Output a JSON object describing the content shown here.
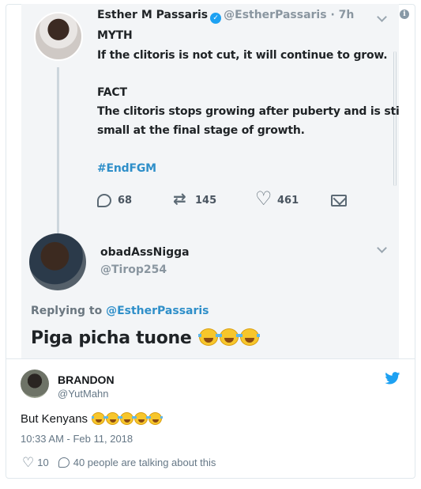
{
  "embedded_tweet": {
    "author_name": "Esther M Passaris",
    "author_handle": "@EstherPassaris",
    "time": "· 7h",
    "lines": [
      "MYTH",
      "If the clitoris is not cut, it will continue to grow.",
      "FACT",
      "The clitoris stops growing after puberty and is still",
      "small at the final stage of growth."
    ],
    "hashtag": "#EndFGM",
    "reply_count": "68",
    "retweet_count": "145",
    "like_count": "461"
  },
  "embedded_reply": {
    "author_name": "obadAssNigga",
    "author_handle": "@Tirop254",
    "replying_prefix": "Replying to",
    "replying_mention": "@EstherPassaris",
    "text": "Piga picha tuone"
  },
  "tweet": {
    "author_name": "BRANDON",
    "author_handle": "@YutMahn",
    "text": "But Kenyans",
    "timestamp": "10:33 AM - Feb 11, 2018",
    "like_count": "10",
    "talking": "40 people are talking about this"
  },
  "icons": {
    "info": "info-icon",
    "bird": "twitter-bird-icon",
    "heart": "heart-icon",
    "reply": "reply-bubble-icon"
  },
  "colors": {
    "link_blue": "#1da1f2",
    "muted": "#657786",
    "border": "#e1e8ed"
  }
}
